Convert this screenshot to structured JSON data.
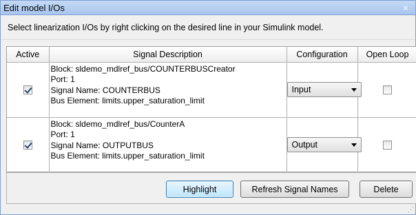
{
  "window": {
    "title": "Edit model I/Os",
    "close_glyph": "×"
  },
  "instruction": "Select linearization I/Os by right clicking on the desired line in your Simulink model.",
  "table": {
    "columns": [
      "Active",
      "Signal Description",
      "Configuration",
      "Open Loop"
    ],
    "rows": [
      {
        "active": true,
        "description": [
          "Block: sldemo_mdlref_bus/COUNTERBUSCreator",
          "Port: 1",
          "Signal Name: COUNTERBUS",
          "Bus Element: limits.upper_saturation_limit"
        ],
        "configuration": "Input",
        "open_loop": false
      },
      {
        "active": true,
        "description": [
          "Block: sldemo_mdlref_bus/CounterA",
          "Port: 1",
          "Signal Name: OUTPUTBUS",
          "Bus Element: limits.upper_saturation_limit"
        ],
        "configuration": "Output",
        "open_loop": false
      }
    ]
  },
  "buttons": {
    "highlight": "Highlight",
    "refresh": "Refresh Signal Names",
    "delete": "Delete"
  },
  "colors": {
    "titlebar": "#a9c6ef",
    "highlight_button": "#bee6fd"
  }
}
